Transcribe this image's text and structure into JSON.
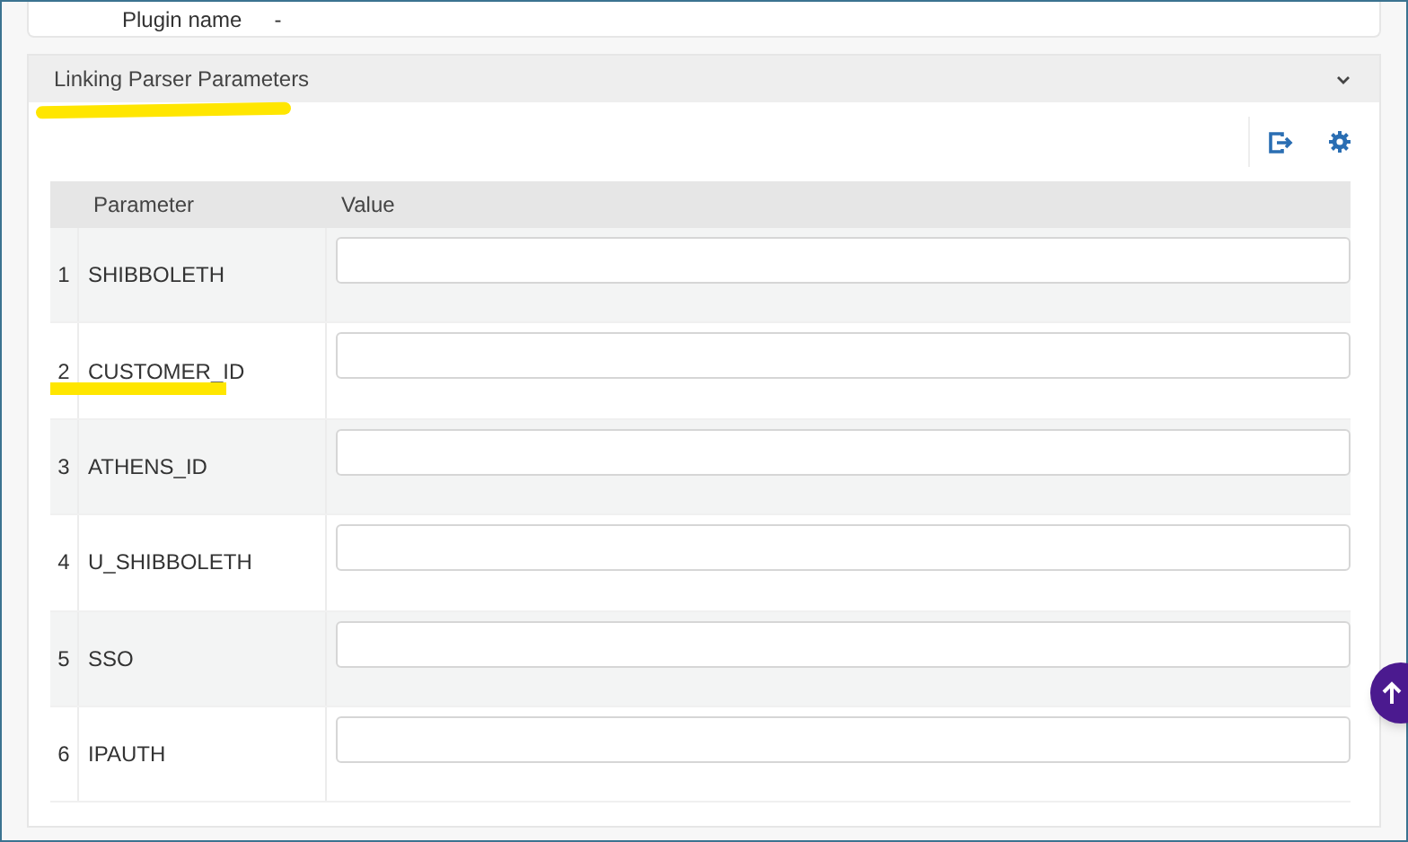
{
  "top_card": {
    "label": "Plugin name",
    "value": "-"
  },
  "section": {
    "title": "Linking Parser Parameters",
    "expanded": true,
    "table": {
      "columns": [
        "Parameter",
        "Value"
      ],
      "rows": [
        {
          "number": "1",
          "parameter": "SHIBBOLETH"
        },
        {
          "number": "2",
          "parameter": "CUSTOMER_ID"
        },
        {
          "number": "3",
          "parameter": "ATHENS_ID"
        },
        {
          "number": "4",
          "parameter": "U_SHIBBOLETH"
        },
        {
          "number": "5",
          "parameter": "SSO"
        },
        {
          "number": "6",
          "parameter": "IPAUTH"
        }
      ]
    }
  }
}
